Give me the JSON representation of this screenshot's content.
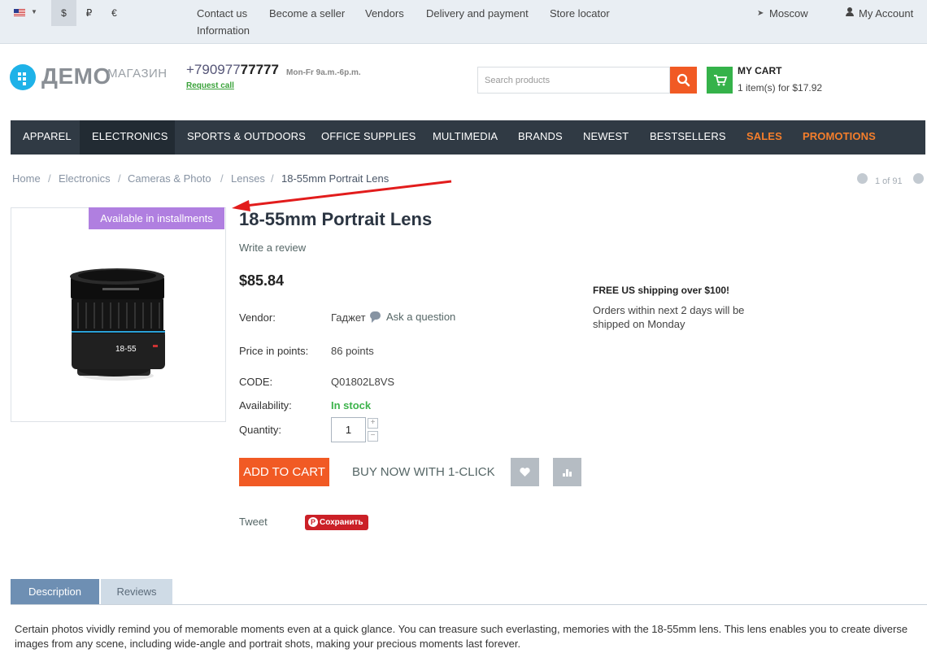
{
  "topbar": {
    "currencies": [
      "$",
      "₽",
      "€"
    ],
    "links": [
      "Contact us",
      "Become a seller",
      "Vendors",
      "Delivery and payment",
      "Store locator",
      "Information"
    ],
    "location": "Moscow",
    "account": "My Account"
  },
  "header": {
    "logo_main": "ДЕМО",
    "logo_sub": "МАГАЗИН",
    "phone_prefix": "+790977",
    "phone_bold": "77777",
    "hours": "Mon-Fr 9a.m.-6p.m.",
    "request_call": "Request call",
    "search_placeholder": "Search products",
    "cart_title": "MY CART",
    "cart_info": "1 item(s) for $17.92"
  },
  "nav": [
    "APPAREL",
    "ELECTRONICS",
    "SPORTS & OUTDOORS",
    "OFFICE SUPPLIES",
    "MULTIMEDIA",
    "BRANDS",
    "NEWEST",
    "BESTSELLERS",
    "SALES",
    "PROMOTIONS"
  ],
  "breadcrumb": [
    "Home",
    "Electronics",
    "Cameras & Photo",
    "Lenses",
    "18-55mm Portrait Lens"
  ],
  "pager": "1 of 91",
  "product": {
    "badge": "Available in installments",
    "title": "18-55mm Portrait Lens",
    "write_review": "Write a review",
    "price": "$85.84",
    "vendor_label": "Vendor:",
    "vendor_value": "Гаджет",
    "ask_question": "Ask a question",
    "points_label": "Price in points:",
    "points_value": "86 points",
    "code_label": "CODE:",
    "code_value": "Q01802L8VS",
    "availability_label": "Availability:",
    "availability_value": "In stock",
    "quantity_label": "Quantity:",
    "quantity_value": "1",
    "add_to_cart": "ADD TO CART",
    "buy_now": "BUY NOW WITH 1-CLICK",
    "tweet": "Tweet",
    "pin": "Сохранить",
    "lens_label": "18-55"
  },
  "shipping": {
    "title": "FREE US shipping over $100!",
    "text": "Orders within next 2 days will be shipped on Monday"
  },
  "tabs": [
    "Description",
    "Reviews"
  ],
  "description": "Certain photos vividly remind you of memorable moments even at a quick glance. You can treasure such everlasting, memories with the 18-55mm lens. This lens enables you to create diverse images from any scene, including wide-angle and portrait shots, making your precious moments last forever."
}
